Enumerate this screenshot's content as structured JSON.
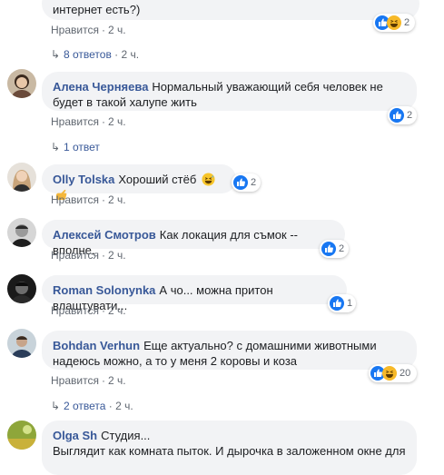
{
  "labels": {
    "like": "Нравится",
    "dot": "·"
  },
  "colors": {
    "link": "#385898",
    "bubble": "#f2f3f5",
    "like_blue": "#1877f2",
    "haha_yellow": "#f7b928"
  },
  "comments": [
    {
      "text": "интернет есть?)",
      "reactions_count": "2",
      "reactions": [
        "like-icon",
        "haha-icon"
      ],
      "time": "2 ч.",
      "replies": "8 ответов",
      "replies_time": "2 ч."
    },
    {
      "author": "Алена Черняева",
      "text": "Нормальный уважающий себя человек не будет в такой халупе жить",
      "reactions_count": "2",
      "reactions": [
        "like-icon"
      ],
      "time": "2 ч.",
      "replies": "1 ответ"
    },
    {
      "author": "Olly Tolska",
      "text": "Хороший стёб",
      "emojis": [
        "grinning-sweat-emoji",
        "pointing-hand-emoji"
      ],
      "reactions_count": "2",
      "reactions": [
        "like-icon"
      ],
      "time": "2 ч."
    },
    {
      "author": "Алексей Смотров",
      "text": "Как локация для съмок -- вполне.",
      "reactions_count": "2",
      "reactions": [
        "like-icon"
      ],
      "time": "2 ч."
    },
    {
      "author": "Roman Solonynka",
      "text": "А чо... можна притон влаштувати...",
      "reactions_count": "1",
      "reactions": [
        "like-icon"
      ],
      "time": "2 ч."
    },
    {
      "author": "Bohdan Verhun",
      "text": "Еще актуально? с домашними животными надеюсь можно, а то у меня 2 коровы и коза",
      "reactions_count": "20",
      "reactions": [
        "like-icon",
        "haha-icon"
      ],
      "time": "2 ч.",
      "replies": "2 ответа",
      "replies_time": "2 ч."
    },
    {
      "author": "Olga Sh",
      "text_line1": "Студия...",
      "text_line2": "Выглядит как комната пыток. И дырочка в заложенном окне для"
    }
  ]
}
